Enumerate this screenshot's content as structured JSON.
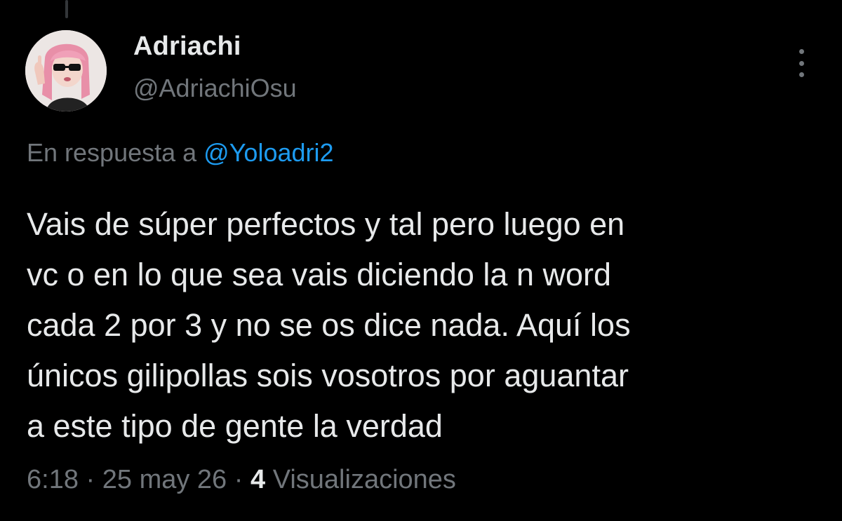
{
  "theme": {
    "background": "#000000",
    "text_primary": "#e7e9ea",
    "text_secondary": "#71767b",
    "link": "#1d9bf0",
    "thread_line": "#333639"
  },
  "author": {
    "display_name": "Adriachi",
    "handle": "@AdriachiOsu",
    "avatar_icon": "profile-avatar"
  },
  "more_menu": {
    "icon": "more-vertical-icon"
  },
  "reply": {
    "prefix": "En respuesta a",
    "mention": "@Yoloadri2"
  },
  "tweet": {
    "lines": [
      "Vais de súper perfectos y tal pero luego en",
      "vc o en lo que sea vais diciendo la n word",
      "cada 2 por 3 y no se os dice nada. Aquí los",
      "únicos gilipollas sois vosotros por aguantar",
      "a este tipo de gente la verdad"
    ]
  },
  "meta": {
    "time": "6:18",
    "separator": "·",
    "date": "25 may 26",
    "views_count": "4",
    "views_label": "Visualizaciones"
  }
}
